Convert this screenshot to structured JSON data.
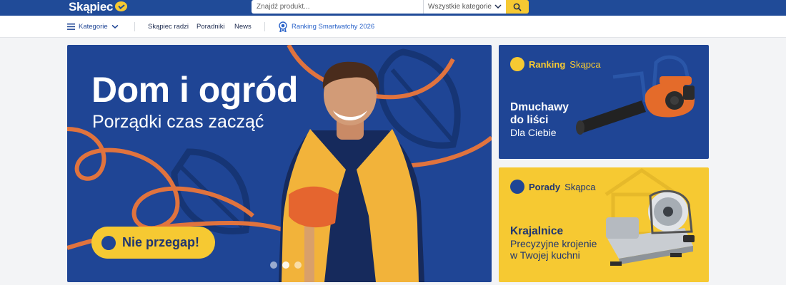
{
  "header": {
    "logo_text": "Skąpiec",
    "search_placeholder": "Znajdź produkt...",
    "category_select": "Wszystkie kategorie",
    "colors": {
      "primary": "#204b98",
      "accent": "#f6c932"
    }
  },
  "nav": {
    "categories_label": "Kategorie",
    "links": [
      "Skąpiec radzi",
      "Poradniki",
      "News"
    ],
    "ranking_label": "Ranking Smartwatchy 2026"
  },
  "hero": {
    "title": "Dom i ogród",
    "subtitle": "Porządki czas zacząć",
    "cta_label": "Nie przegap!",
    "slides_total": 3,
    "active_slide": 2
  },
  "cards": [
    {
      "head_strong": "Ranking",
      "head_light": "Skąpca",
      "title_line1": "Dmuchawy",
      "title_line2": "do liści",
      "text_line1": "Dla Ciebie",
      "icon": "leaf-blower-image"
    },
    {
      "head_strong": "Porady",
      "head_light": "Skąpca",
      "title_line1": "Krajalnice",
      "text_line1": "Precyzyjne krojenie",
      "text_line2": "w Twojej kuchni",
      "icon": "food-slicer-image"
    }
  ]
}
